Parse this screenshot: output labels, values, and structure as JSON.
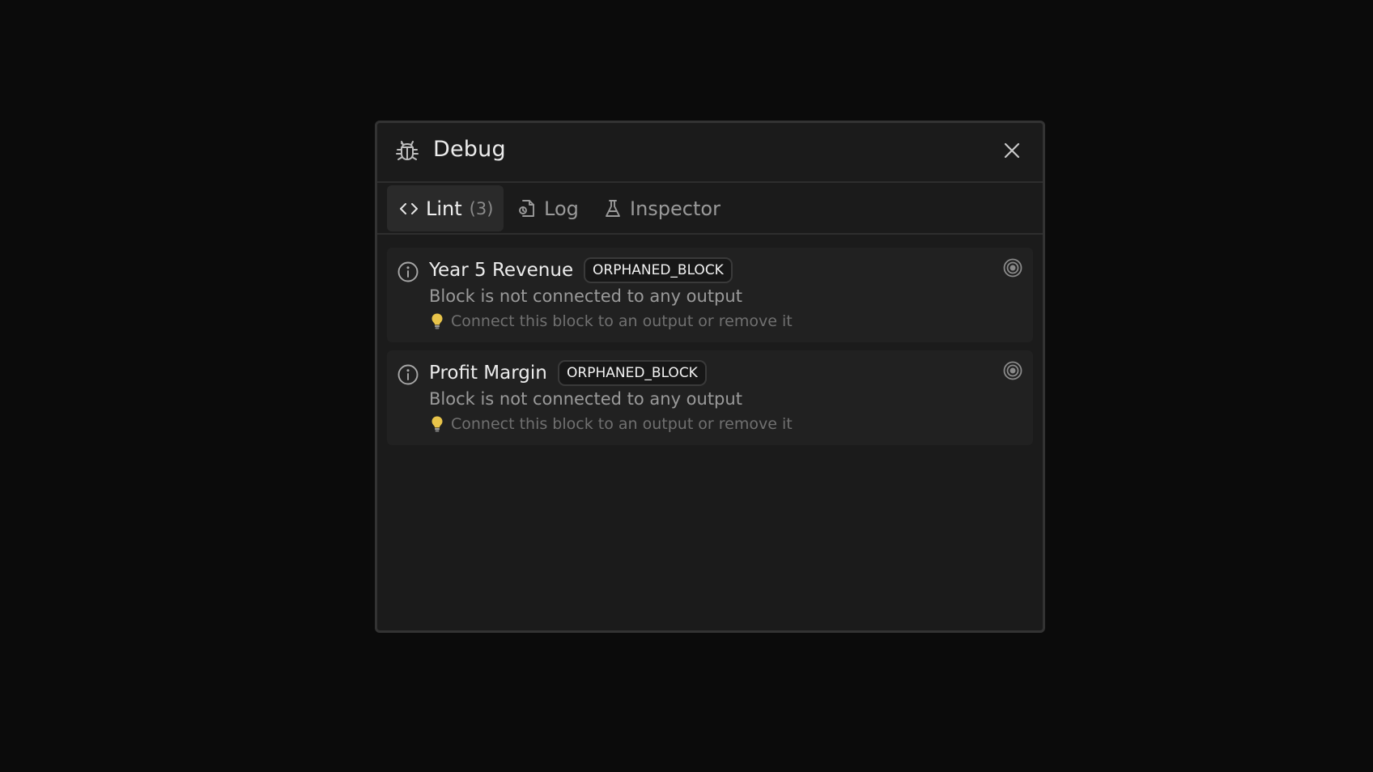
{
  "dialog": {
    "title": "Debug",
    "title_icon": "bug-icon",
    "close_icon": "close-icon"
  },
  "tabs": [
    {
      "label": "Lint",
      "count": "(3)",
      "icon": "code-brackets-icon",
      "active": true
    },
    {
      "label": "Log",
      "icon": "document-icon",
      "active": false
    },
    {
      "label": "Inspector",
      "icon": "flask-icon",
      "active": false
    }
  ],
  "issues": [
    {
      "title": "Year 5 Revenue",
      "code": "ORPHANED_BLOCK",
      "message": "Block is not connected to any output",
      "hint": "Connect this block to an output or remove it"
    },
    {
      "title": "Profit Margin",
      "code": "ORPHANED_BLOCK",
      "message": "Block is not connected to any output",
      "hint": "Connect this block to an output or remove it"
    }
  ],
  "colors": {
    "background": "#0b0b0b",
    "panel": "#1b1b1b",
    "issue_row": "#212121",
    "active_tab": "#2a2a2a",
    "bulb": "#e8c44a"
  }
}
